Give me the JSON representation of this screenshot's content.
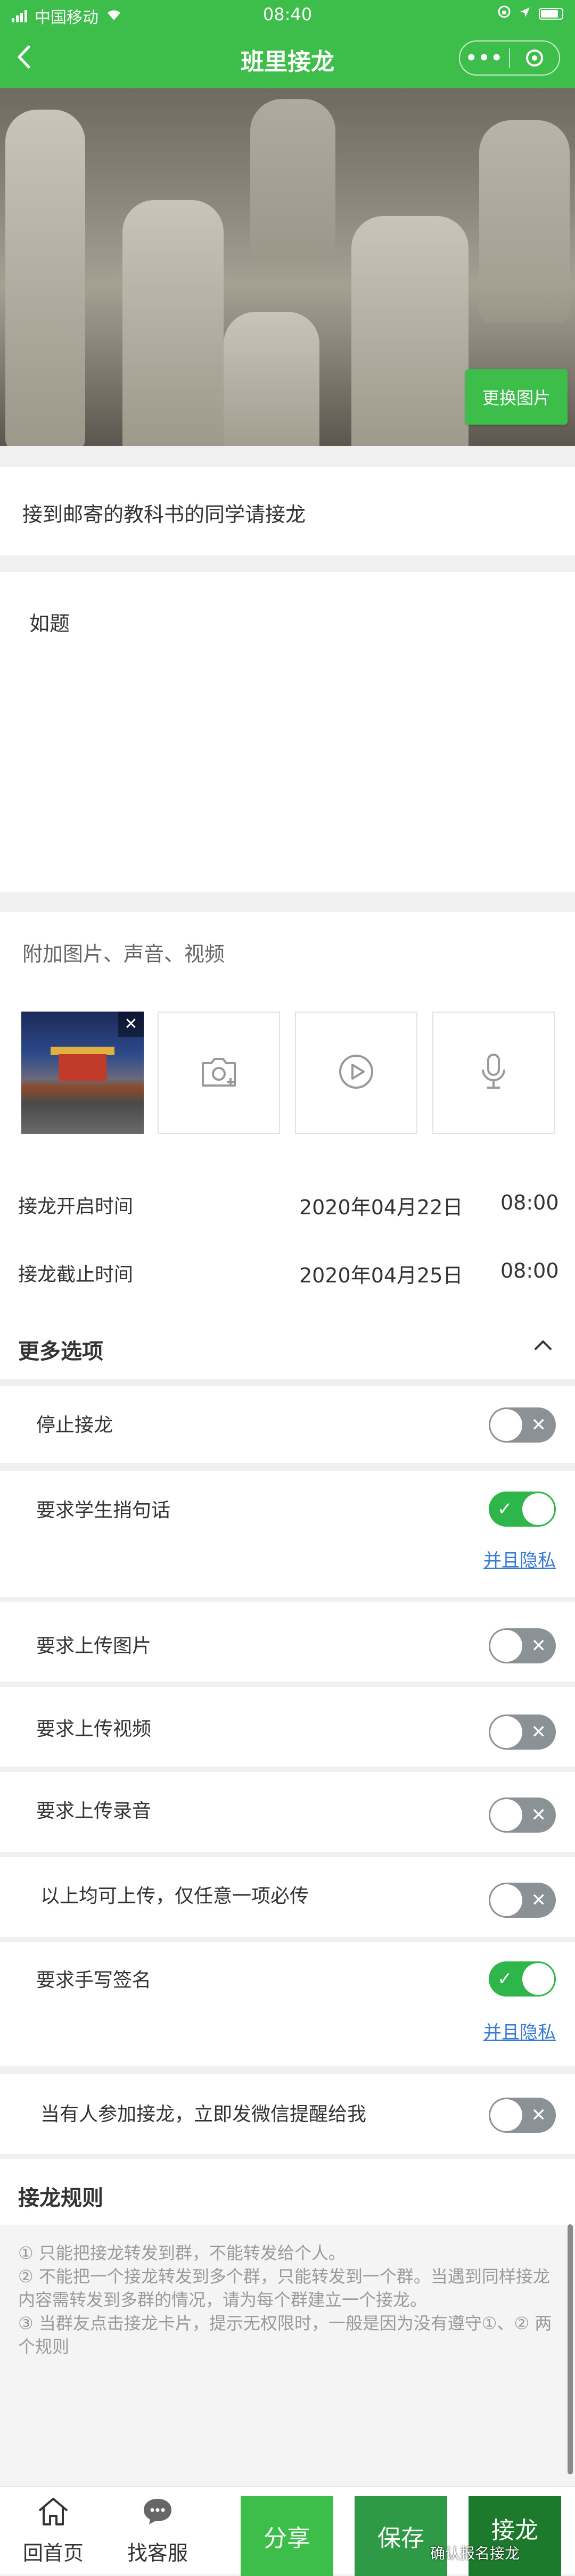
{
  "status_bar": {
    "carrier": "中国移动",
    "time": "08:40"
  },
  "nav": {
    "title": "班里接龙",
    "more_icon": "more-dots-icon",
    "close_icon": "target-icon"
  },
  "cover": {
    "change_button": "更换图片"
  },
  "form": {
    "title_text": "接到邮寄的教科书的同学请接龙",
    "description_text": "如题",
    "attach_label": "附加图片、声音、视频",
    "attachments": {
      "close_glyph": "✕"
    }
  },
  "times": {
    "start": {
      "label": "接龙开启时间",
      "date": "2020年04月22日",
      "time": "08:00"
    },
    "end": {
      "label": "接龙截止时间",
      "date": "2020年04月25日",
      "time": "08:00"
    }
  },
  "more_options": {
    "label": "更多选项",
    "items": [
      {
        "label": "停止接龙",
        "on": false
      },
      {
        "label": "要求学生捎句话",
        "on": true,
        "link": "并且隐私"
      },
      {
        "label": "要求上传图片",
        "on": false
      },
      {
        "label": "要求上传视频",
        "on": false
      },
      {
        "label": "要求上传录音",
        "on": false
      },
      {
        "label": "以上均可上传，仅任意一项必传",
        "on": false
      },
      {
        "label": "要求手写签名",
        "on": true,
        "link": "并且隐私"
      },
      {
        "label": "当有人参加接龙，立即发微信提醒给我",
        "on": false
      }
    ]
  },
  "rules": {
    "label": "接龙规则",
    "text": "① 只能把接龙转发到群，不能转发给个人。\n② 不能把一个接龙转发到多个群，只能转发到一个群。当遇到同样接龙内容需转发到多群的情况，请为每个群建立一个接龙。\n③ 当群友点击接龙卡片，提示无权限时，一般是因为没有遵守①、② 两个规则"
  },
  "bottom_bar": {
    "home": "回首页",
    "service": "找客服",
    "share": "分享",
    "save": "保存",
    "join": "接龙",
    "watermark": "确认报名接龙",
    "colors": {
      "share": "#3dbd4a",
      "save": "#2e9a45",
      "join": "#1d7a2c"
    }
  }
}
